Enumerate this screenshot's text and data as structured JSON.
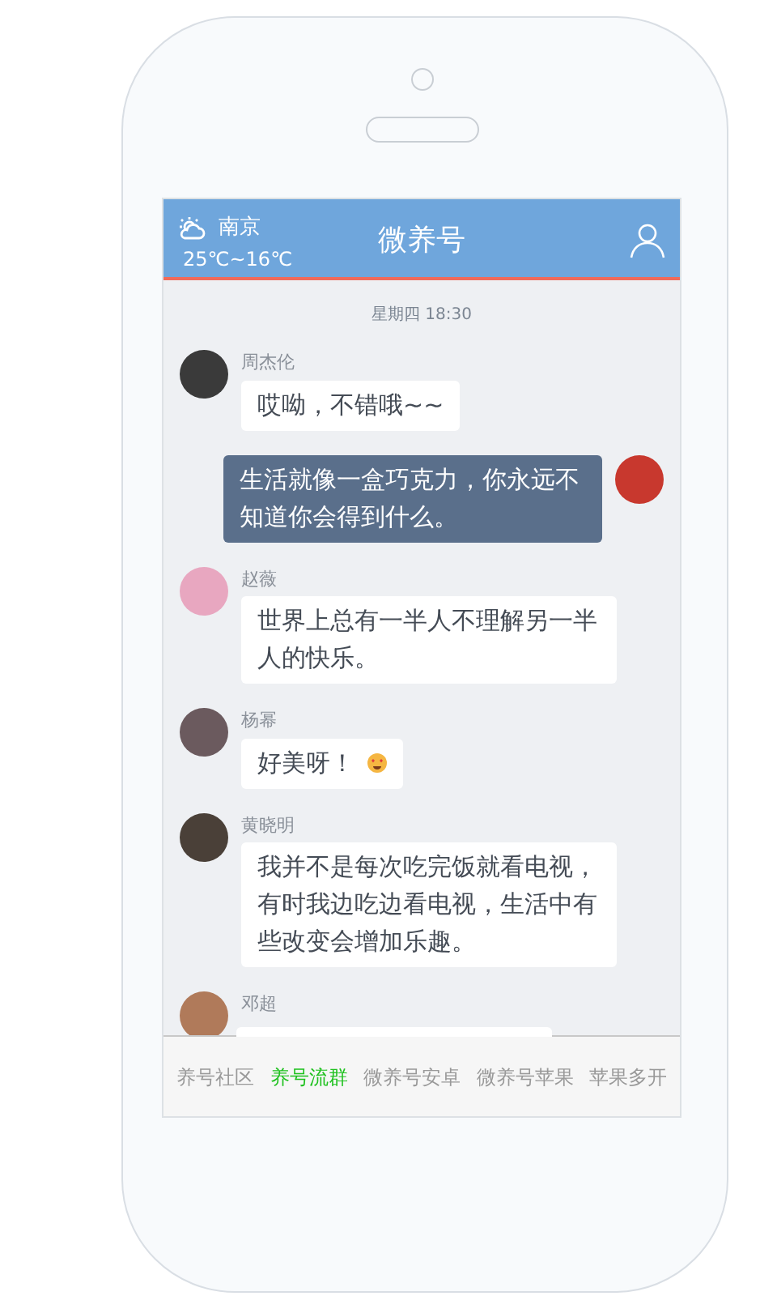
{
  "header": {
    "city": "南京",
    "temperature": "25℃~16℃",
    "title": "微养号"
  },
  "messages": [
    {
      "kind": "time",
      "text": "星期四 18:30"
    },
    {
      "kind": "left",
      "name": "周杰伦",
      "text": "哎呦，不错哦~~",
      "color": "#3a3a3a"
    },
    {
      "kind": "right",
      "text": "生活就像一盒巧克力，你永远不知道你会得到什么。",
      "color": "#c8382e"
    },
    {
      "kind": "left",
      "name": "赵薇",
      "text": "世界上总有一半人不理解另一半人的快乐。",
      "color": "#e8a7c0"
    },
    {
      "kind": "left",
      "name": "杨幂",
      "text": "好美呀！",
      "emoji": true,
      "color": "#6b5a5e"
    },
    {
      "kind": "left",
      "name": "黄晓明",
      "text": "我并不是每次吃完饭就看电视，有时我边吃边看电视，生活中有些改变会增加乐趣。",
      "color": "#4a4038"
    },
    {
      "kind": "cut",
      "name": "邓超",
      "color": "#b07a5a"
    }
  ],
  "tabs": [
    {
      "label": "养号社区",
      "selected": false
    },
    {
      "label": "养号流群",
      "selected": true
    },
    {
      "label": "微养号安卓",
      "selected": false
    },
    {
      "label": "微养号苹果",
      "selected": false
    },
    {
      "label": "苹果多开",
      "selected": false
    }
  ]
}
